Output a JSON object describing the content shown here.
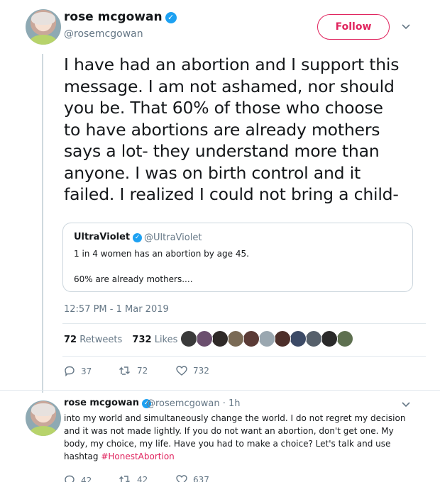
{
  "main_tweet": {
    "author_name": "rose mcgowan",
    "handle": "@rosemcgowan",
    "follow_label": "Follow",
    "verified_glyph": "✓",
    "text_lines": [
      "I have had an abortion and I support this",
      "message. I am not ashamed, nor should",
      "you be. That 60% of those who choose",
      "to have abortions are already mothers",
      "says a lot- they understand more than",
      "anyone. I was on birth control and it",
      "failed. I realized I could not bring a child-"
    ],
    "quote": {
      "author_name": "UltraViolet",
      "handle": "@UltraViolet",
      "line1": "1 in 4 women has an abortion by age 45.",
      "line2": "60% are already mothers...."
    },
    "timestamp": "12:57 PM - 1 Mar 2019",
    "retweets_count": "72",
    "retweets_label": "Retweets",
    "likes_count": "732",
    "likes_label": "Likes",
    "liker_colors": [
      "#3a3a3a",
      "#6b4f6e",
      "#2f2a28",
      "#7a6a55",
      "#5b3b36",
      "#9aa7b0",
      "#4d2f2a",
      "#3c4a66",
      "#56606b",
      "#2a2a2a",
      "#5e7050"
    ],
    "actions": {
      "replies": "37",
      "retweets": "72",
      "likes": "732"
    }
  },
  "reply_tweet": {
    "author_name": "rose mcgowan",
    "handle": "@rosemcgowan · 1h",
    "text_lines": [
      "into my world and simultaneously change the world. I do not regret my decision",
      "and it was not made lightly. If you do not want an abortion, don't get one. My",
      "body, my choice, my life. Have you had to make a choice? Let's talk and use"
    ],
    "last_line_prefix": "hashtag ",
    "hashtag": "#HonestAbortion",
    "actions": {
      "replies": "42",
      "retweets": "42",
      "likes": "637"
    }
  },
  "colors": {
    "accent": "#e0245e",
    "verified": "#1da1f2",
    "muted": "#657786"
  }
}
